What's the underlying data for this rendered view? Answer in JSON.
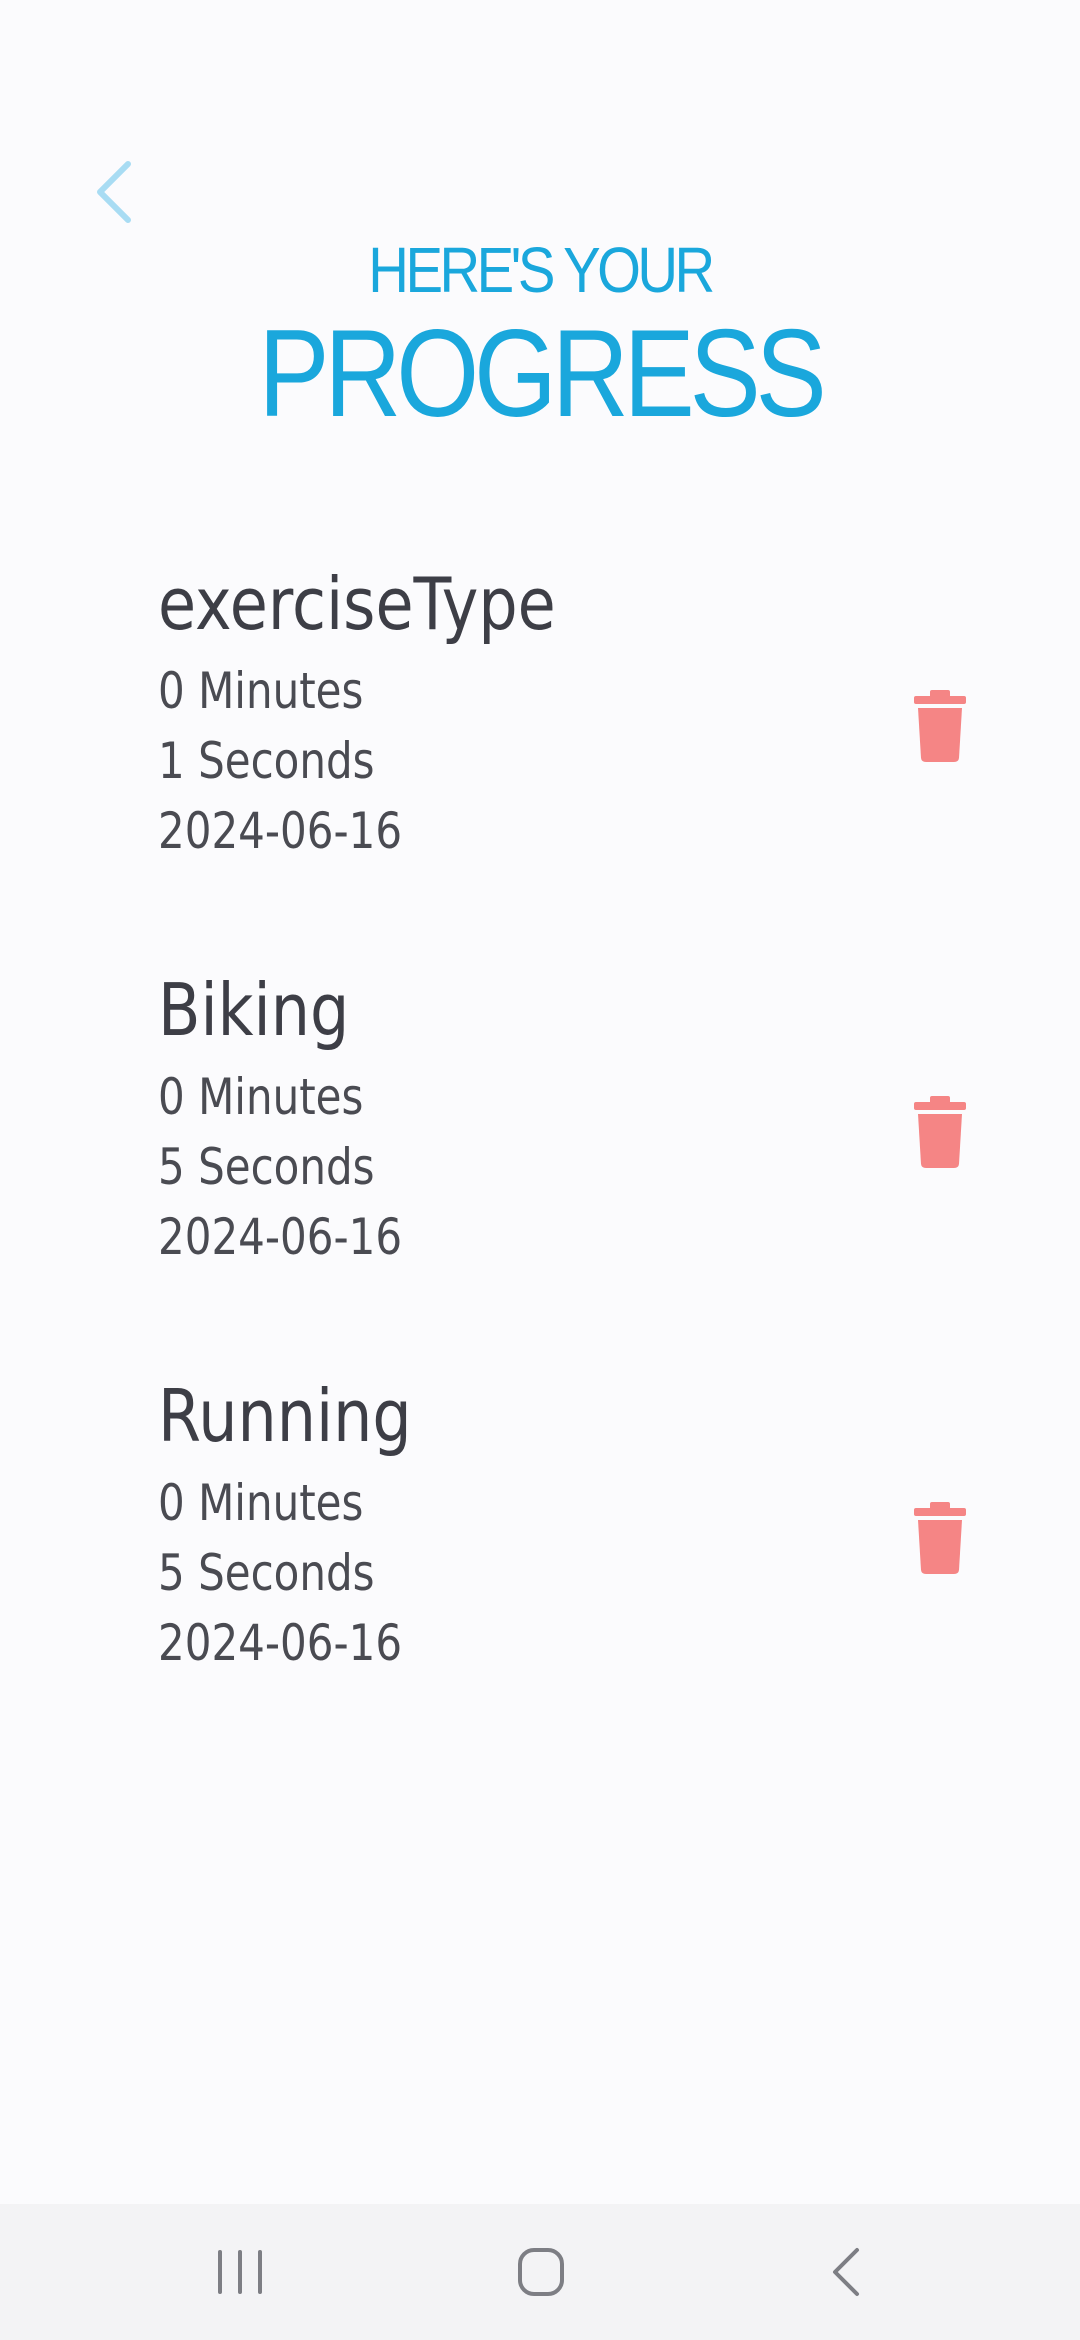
{
  "colors": {
    "accent": "#1aa7dc",
    "back_arrow": "#a8dcf3",
    "delete": "#f58585",
    "nav_icon": "#7d7e84"
  },
  "icons": {
    "back": "chevron-left-icon",
    "delete": "trash-icon",
    "nav_recents": "recents-icon",
    "nav_home": "home-icon",
    "nav_back": "back-icon"
  },
  "header": {
    "line1": "HERE'S YOUR",
    "line2": "PROGRESS"
  },
  "entries": [
    {
      "type": "exerciseType",
      "minutes": "0 Minutes",
      "seconds": "1 Seconds",
      "date": "2024-06-16"
    },
    {
      "type": "Biking",
      "minutes": "0 Minutes",
      "seconds": "5 Seconds",
      "date": "2024-06-16"
    },
    {
      "type": "Running",
      "minutes": "0 Minutes",
      "seconds": "5 Seconds",
      "date": "2024-06-16"
    }
  ]
}
